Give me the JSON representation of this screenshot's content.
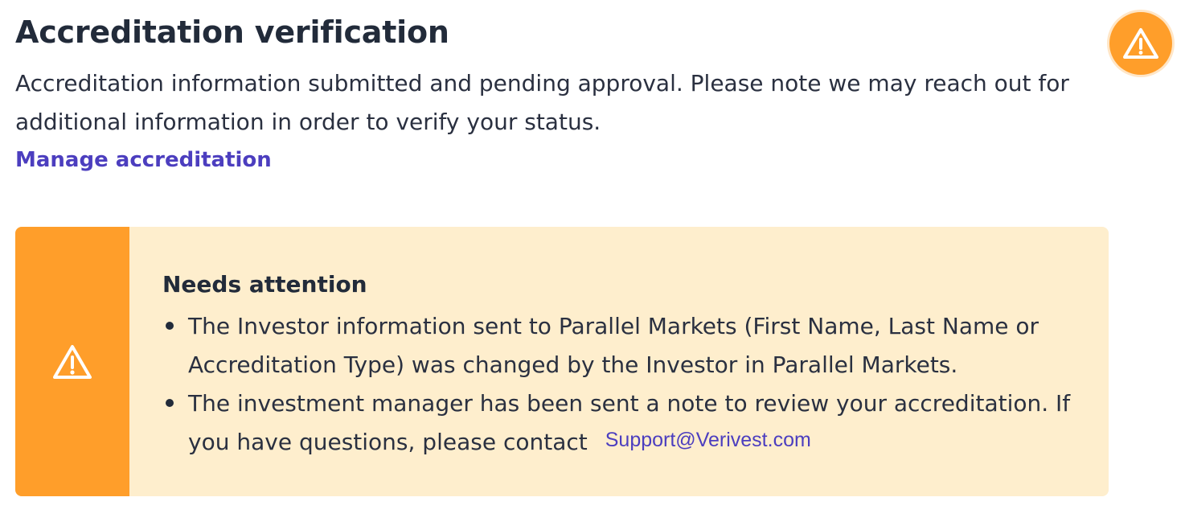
{
  "header": {
    "title": "Accreditation verification",
    "status_icon": "warning-icon",
    "status_color": "#ff9e2a"
  },
  "description": "Accreditation information submitted and pending approval. Please note we may reach out for additional information in order to verify your status.",
  "manage_link": "Manage accreditation",
  "alert": {
    "icon": "warning-icon",
    "accent_color": "#ff9e2a",
    "background_color": "#feeecd",
    "title": "Needs attention",
    "items": [
      "The Investor information sent to Parallel Markets (First Name, Last Name or Accreditation Type) was changed by the Investor in Parallel Markets.",
      "The investment manager has been sent a note to review your accreditation. If you have questions, please contact"
    ],
    "contact_email": "Support@Verivest.com"
  },
  "colors": {
    "link": "#4c3ebf",
    "heading": "#222b3a"
  }
}
